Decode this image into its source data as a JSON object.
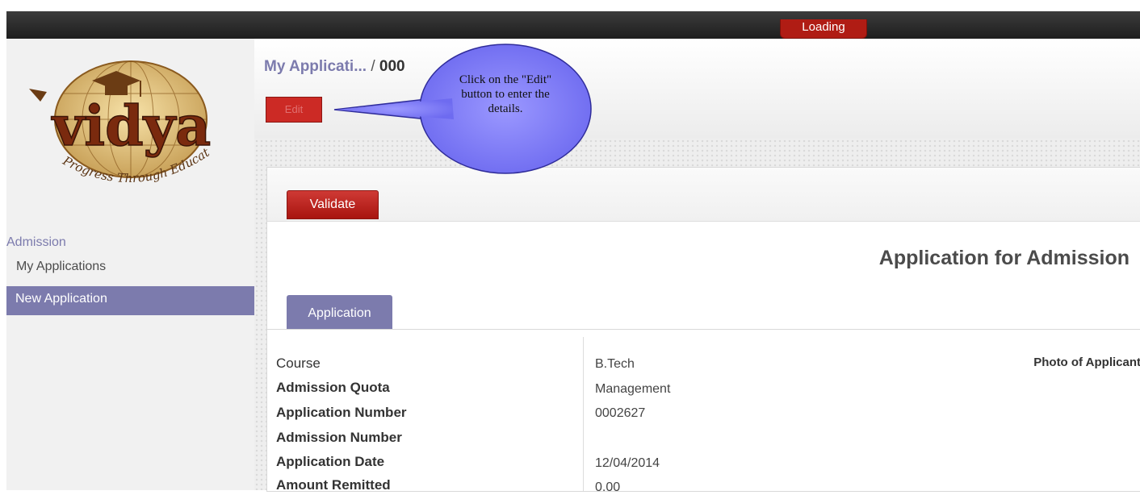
{
  "topbar": {
    "loading_label": "Loading"
  },
  "sidebar": {
    "logo": {
      "brand": "vidya",
      "tagline": "Progress Through Education"
    },
    "section_title": "Admission",
    "items": [
      {
        "label": "My Applications",
        "active": false
      },
      {
        "label": "New Application",
        "active": true
      }
    ]
  },
  "header": {
    "breadcrumb_parent": "My Applicati...",
    "breadcrumb_sep": "/",
    "breadcrumb_current": "000",
    "edit_label": "Edit"
  },
  "callout": {
    "text": "Click on the \"Edit\" button to enter the details."
  },
  "form": {
    "validate_label": "Validate",
    "title": "Application for Admission",
    "tab_label": "Application",
    "photo_label": "Photo of Applicant",
    "fields": [
      {
        "label": "Course",
        "value": "B.Tech"
      },
      {
        "label": "Admission Quota",
        "value": "Management"
      },
      {
        "label": "Application Number",
        "value": "0002627"
      },
      {
        "label": "Admission Number",
        "value": ""
      },
      {
        "label": "Application Date",
        "value": "12/04/2014"
      },
      {
        "label": "Amount Remitted",
        "value": "0.00"
      }
    ]
  },
  "colors": {
    "accent": "#7c7bad",
    "danger": "#cc2a25",
    "callout": "#7b78f0"
  }
}
